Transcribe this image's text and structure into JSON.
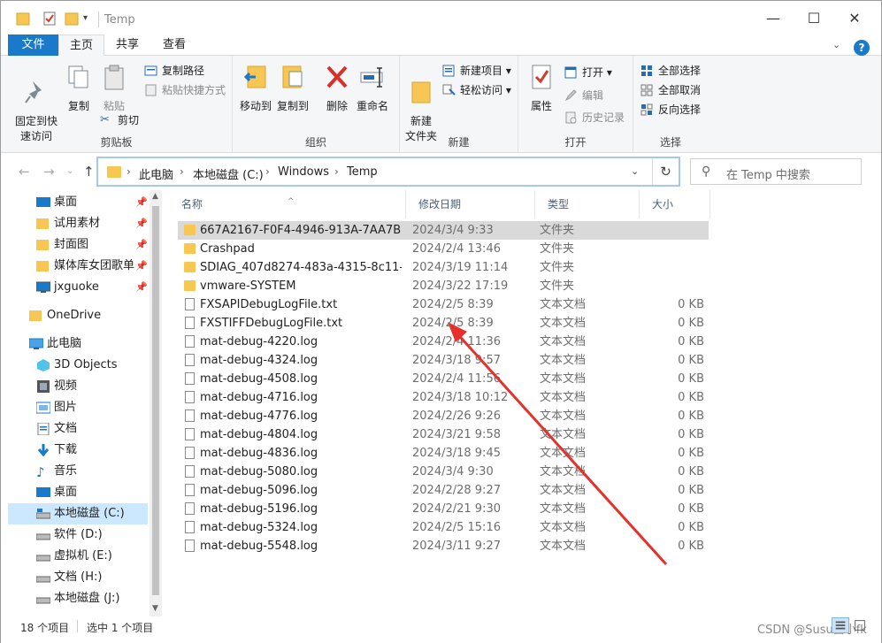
{
  "window": {
    "title": "Temp",
    "min_glyph": "—",
    "max_glyph": "☐",
    "close_glyph": "✕"
  },
  "ribbon_tabs": {
    "file": "文件",
    "home": "主页",
    "share": "共享",
    "view": "查看"
  },
  "ribbon": {
    "clipboard": {
      "label": "剪贴板",
      "pin": "固定到快\n速访问",
      "copy": "复制",
      "paste": "粘贴",
      "copy_path": "复制路径",
      "paste_shortcut": "粘贴快捷方式",
      "cut": "剪切"
    },
    "organize": {
      "label": "组织",
      "move_to": "移动到",
      "copy_to": "复制到",
      "delete": "删除",
      "rename": "重命名"
    },
    "new": {
      "label": "新建",
      "new_folder": "新建\n文件夹",
      "new_item": "新建项目",
      "easy_access": "轻松访问"
    },
    "open": {
      "label": "打开",
      "properties": "属性",
      "open": "打开",
      "edit": "编辑",
      "history": "历史记录"
    },
    "select": {
      "label": "选择",
      "select_all": "全部选择",
      "select_none": "全部取消",
      "invert": "反向选择"
    }
  },
  "address": {
    "crumbs": [
      "此电脑",
      "本地磁盘 (C:)",
      "Windows",
      "Temp"
    ],
    "search_placeholder": "在 Temp 中搜索"
  },
  "nav": {
    "items": [
      {
        "label": "桌面",
        "icon": "desktop-icon",
        "pinned": true
      },
      {
        "label": "试用素材",
        "icon": "folder-icon",
        "pinned": true
      },
      {
        "label": "封面图",
        "icon": "folder-icon",
        "pinned": true
      },
      {
        "label": "媒体库女团歌单",
        "icon": "folder-icon",
        "pinned": true
      },
      {
        "label": "jxguoke",
        "icon": "monitor-icon",
        "pinned": true
      },
      {
        "label": "OneDrive",
        "icon": "folder-icon",
        "pinned": false
      },
      {
        "label": "此电脑",
        "icon": "pc-icon",
        "pinned": false
      },
      {
        "label": "3D Objects",
        "icon": "cube-icon",
        "pinned": false
      },
      {
        "label": "视频",
        "icon": "video-icon",
        "pinned": false
      },
      {
        "label": "图片",
        "icon": "picture-icon",
        "pinned": false
      },
      {
        "label": "文档",
        "icon": "document-icon",
        "pinned": false
      },
      {
        "label": "下载",
        "icon": "download-icon",
        "pinned": false
      },
      {
        "label": "音乐",
        "icon": "music-icon",
        "pinned": false
      },
      {
        "label": "桌面",
        "icon": "desktop-icon",
        "pinned": false
      },
      {
        "label": "本地磁盘 (C:)",
        "icon": "drive-icon",
        "pinned": false
      },
      {
        "label": "软件 (D:)",
        "icon": "drive-icon",
        "pinned": false
      },
      {
        "label": "虚拟机 (E:)",
        "icon": "drive-icon",
        "pinned": false
      },
      {
        "label": "文档 (H:)",
        "icon": "drive-icon",
        "pinned": false
      },
      {
        "label": "本地磁盘 (J:)",
        "icon": "drive-icon",
        "pinned": false
      }
    ]
  },
  "columns": {
    "name": "名称",
    "date": "修改日期",
    "type": "类型",
    "size": "大小"
  },
  "files": [
    {
      "name": "667A2167-F0F4-4946-913A-7AA7B5B...",
      "date": "2024/3/4 9:33",
      "type": "文件夹",
      "size": "",
      "kind": "folder"
    },
    {
      "name": "Crashpad",
      "date": "2024/2/4 13:46",
      "type": "文件夹",
      "size": "",
      "kind": "folder"
    },
    {
      "name": "SDIAG_407d8274-483a-4315-8c11-57...",
      "date": "2024/3/19 11:14",
      "type": "文件夹",
      "size": "",
      "kind": "folder"
    },
    {
      "name": "vmware-SYSTEM",
      "date": "2024/3/22 17:19",
      "type": "文件夹",
      "size": "",
      "kind": "folder"
    },
    {
      "name": "FXSAPIDebugLogFile.txt",
      "date": "2024/2/5 8:39",
      "type": "文本文档",
      "size": "0 KB",
      "kind": "doc"
    },
    {
      "name": "FXSTIFFDebugLogFile.txt",
      "date": "2024/2/5 8:39",
      "type": "文本文档",
      "size": "0 KB",
      "kind": "doc"
    },
    {
      "name": "mat-debug-4220.log",
      "date": "2024/2/4 11:36",
      "type": "文本文档",
      "size": "0 KB",
      "kind": "doc"
    },
    {
      "name": "mat-debug-4324.log",
      "date": "2024/3/18 9:57",
      "type": "文本文档",
      "size": "0 KB",
      "kind": "doc"
    },
    {
      "name": "mat-debug-4508.log",
      "date": "2024/2/4 11:56",
      "type": "文本文档",
      "size": "0 KB",
      "kind": "doc"
    },
    {
      "name": "mat-debug-4716.log",
      "date": "2024/3/18 10:12",
      "type": "文本文档",
      "size": "0 KB",
      "kind": "doc"
    },
    {
      "name": "mat-debug-4776.log",
      "date": "2024/2/26 9:26",
      "type": "文本文档",
      "size": "0 KB",
      "kind": "doc"
    },
    {
      "name": "mat-debug-4804.log",
      "date": "2024/3/21 9:58",
      "type": "文本文档",
      "size": "0 KB",
      "kind": "doc"
    },
    {
      "name": "mat-debug-4836.log",
      "date": "2024/3/18 9:45",
      "type": "文本文档",
      "size": "0 KB",
      "kind": "doc"
    },
    {
      "name": "mat-debug-5080.log",
      "date": "2024/3/4 9:30",
      "type": "文本文档",
      "size": "0 KB",
      "kind": "doc"
    },
    {
      "name": "mat-debug-5096.log",
      "date": "2024/2/28 9:27",
      "type": "文本文档",
      "size": "0 KB",
      "kind": "doc"
    },
    {
      "name": "mat-debug-5196.log",
      "date": "2024/2/21 9:30",
      "type": "文本文档",
      "size": "0 KB",
      "kind": "doc"
    },
    {
      "name": "mat-debug-5324.log",
      "date": "2024/2/5 15:16",
      "type": "文本文档",
      "size": "0 KB",
      "kind": "doc"
    },
    {
      "name": "mat-debug-5548.log",
      "date": "2024/3/11 9:27",
      "type": "文本文档",
      "size": "0 KB",
      "kind": "doc"
    }
  ],
  "selected_index": 0,
  "status": {
    "count": "18 个项目",
    "selected": "选中 1 个项目"
  },
  "watermark": "CSDN @Susu酱小fk",
  "colors": {
    "accent": "#1979ca",
    "folder": "#f8c753",
    "annotation": "#e8302a",
    "selection": "#d9d9d9"
  }
}
